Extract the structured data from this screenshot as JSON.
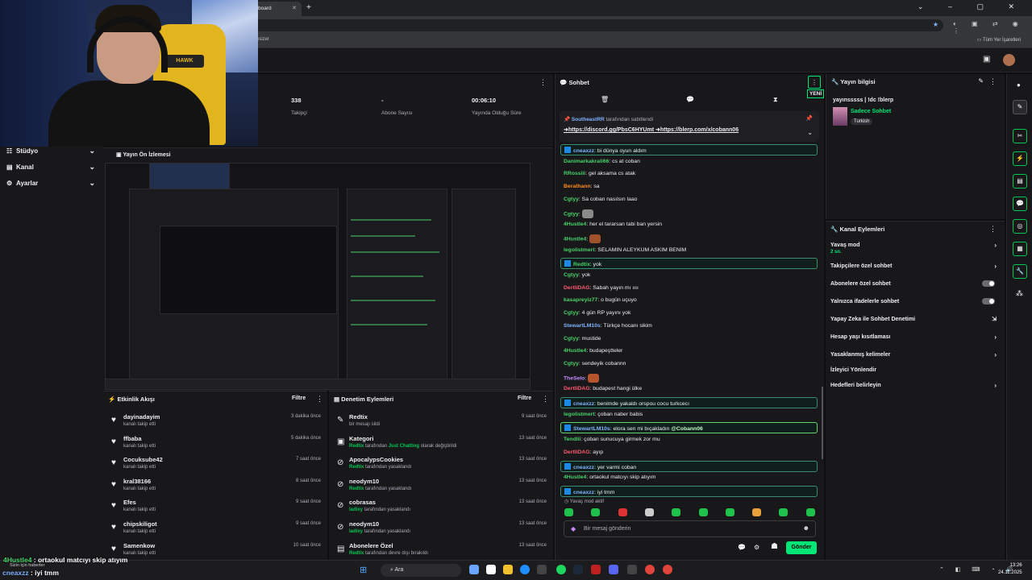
{
  "browser": {
    "tab_title": "board",
    "bookmarks_left": "esizer",
    "bookmarks_right": "Tüm Yer İşaretleri"
  },
  "nav": {
    "items": [
      {
        "label": "Stüdyo"
      },
      {
        "label": "Kanal"
      },
      {
        "label": "Ayarlar"
      }
    ]
  },
  "stats": {
    "items": [
      {
        "value": "338",
        "label": "Takipçi"
      },
      {
        "value": "-",
        "label": "Abone Sayısı"
      },
      {
        "value": "00:06:10",
        "label": "Yayında Olduğu Süre"
      }
    ]
  },
  "preview": {
    "title": "Yayın Ön İzlemesi"
  },
  "feed": {
    "title": "Etkinlik Akışı",
    "filter": "Filtre",
    "items": [
      {
        "name": "dayinadayim",
        "sub": "kanalı takip etti",
        "time": "3 dakika önce"
      },
      {
        "name": "ffbaba",
        "sub": "kanalı takip etti",
        "time": "5 dakika önce"
      },
      {
        "name": "Cocuksube42",
        "sub": "kanalı takip etti",
        "time": "7 saat önce"
      },
      {
        "name": "kral38166",
        "sub": "kanalı takip etti",
        "time": "8 saat önce"
      },
      {
        "name": "Efes",
        "sub": "kanalı takip etti",
        "time": "9 saat önce"
      },
      {
        "name": "chipskiligot",
        "sub": "kanalı takip etti",
        "time": "9 saat önce"
      },
      {
        "name": "Samenkow",
        "sub": "kanalı takip etti",
        "time": "10 saat önce"
      }
    ]
  },
  "mod": {
    "title": "Denetim Eylemleri",
    "filter": "Filtre",
    "items": [
      {
        "name": "Redtix",
        "actor": "",
        "sub": "bir mesajı sildi",
        "time": "9 saat önce"
      },
      {
        "name": "Kategori",
        "actor": "Redtix",
        "sub": " tarafından ",
        "extra": "Just Chatting",
        "sub2": " olarak değiştirildi",
        "time": "13 saat önce"
      },
      {
        "name": "ApocalypsCookies",
        "actor": "Redtix",
        "sub": " tarafından yasaklandı",
        "time": "13 saat önce"
      },
      {
        "name": "neodym10",
        "actor": "Redtix",
        "sub": " tarafından yasaklandı",
        "time": "13 saat önce"
      },
      {
        "name": "cobrasas",
        "actor": "ladixy",
        "sub": " tarafından yasaklandı",
        "time": "13 saat önce"
      },
      {
        "name": "neodym10",
        "actor": "ladixy",
        "sub": " tarafından yasaklandı",
        "time": "13 saat önce"
      },
      {
        "name": "Abonelere Özel",
        "actor": "Redtix",
        "sub": " tarafından devre dışı bırakıldı",
        "time": "13 saat önce"
      }
    ]
  },
  "chat": {
    "title": "Sohbet",
    "new_badge": "YENİ",
    "pinned_by": "SoutheastRR",
    "pinned_suffix": " tarafından sabitlendi",
    "pinned_text": "➜https://discord.gg/PbsC6HYUmt ➜https://blerp.com/x/cobann06",
    "slow_mode": "Yavaş mod aktif",
    "input_placeholder": "Bir mesaj gönderin",
    "send": "Gönder",
    "messages": [
      {
        "user": "cneaxzz",
        "color": "#7fb2ff",
        "text": ": bi dünya oyun aldım",
        "hl": true
      },
      {
        "user": "Danimarkakrali66",
        "color": "#48d26a",
        "text": ": cs at coban"
      },
      {
        "user": "RRossiii",
        "color": "#48d26a",
        "text": ": gel aksama cs atak"
      },
      {
        "user": "Berathann",
        "color": "#ff8c1a",
        "text": ": sa"
      },
      {
        "user": "Cgtyy",
        "color": "#48d26a",
        "text": ": Sa coban nasılsın laao"
      },
      {
        "user": "Cgtyy",
        "color": "#48d26a",
        "text": ":",
        "emote": "#8a8a8a"
      },
      {
        "user": "4Hustle4",
        "color": "#48d26a",
        "text": ": her el tararsan tabi ban yersin"
      },
      {
        "user": "4Hustle4",
        "color": "#48d26a",
        "text": ":",
        "emote": "#a0522d"
      },
      {
        "user": "legolistmert",
        "color": "#48d26a",
        "text": ": SELAMIN ALEYKÜM ASKIM BENİM"
      },
      {
        "user": "Redtix",
        "color": "#48d26a",
        "text": ": yok",
        "hl": true
      },
      {
        "user": "Cgtyy",
        "color": "#48d26a",
        "text": ": yok"
      },
      {
        "user": "DertliDAG",
        "color": "#ff5a6e",
        "text": ": Sabah yayın mı ıııı"
      },
      {
        "user": "kasapreyiz77",
        "color": "#48d26a",
        "text": ": o bugün uçuyo"
      },
      {
        "user": "Cgtyy",
        "color": "#48d26a",
        "text": ": 4 gün RP yayını yok"
      },
      {
        "user": "StewartLM10s",
        "color": "#7fb2ff",
        "text": ": Türkçe hocanı sikim"
      },
      {
        "user": "Cgtyy",
        "color": "#48d26a",
        "text": ": mustide"
      },
      {
        "user": "4Hustle4",
        "color": "#48d26a",
        "text": ": budapeştteler"
      },
      {
        "user": "Cgtyy",
        "color": "#48d26a",
        "text": ": sendeyik cobannn"
      },
      {
        "user": "TheSelo",
        "color": "#c58bff",
        "text": ":",
        "emote": "#b5542d"
      },
      {
        "user": "DertliDAG",
        "color": "#ff5a6e",
        "text": ": budapest hangi ülke"
      },
      {
        "user": "cneaxzz",
        "color": "#7fb2ff",
        "text": ": benimde yakaldı orspou cocu turkcecı",
        "hl": true
      },
      {
        "user": "legolistmert",
        "color": "#48d26a",
        "text": ": çoban naber babis"
      },
      {
        "user": "StewartLM10s",
        "color": "#7fb2ff",
        "text": ": elora sen mi bıçakladın ",
        "mention": "@Cobann06",
        "hl": true,
        "hlg": true
      },
      {
        "user": "Tendlii",
        "color": "#48d26a",
        "text": ": çoban sunucuya girmek zor mu"
      },
      {
        "user": "DertliDAG",
        "color": "#ff5a6e",
        "text": ": ayıp"
      },
      {
        "user": "cneaxzz",
        "color": "#7fb2ff",
        "text": ": yer varmi coban",
        "hl": true
      },
      {
        "user": "4Hustle4",
        "color": "#48d26a",
        "text": ": ortaokul matcıyı skip atıyım"
      },
      {
        "user": "cneaxzz",
        "color": "#7fb2ff",
        "text": ": iyi tmm",
        "hl": true
      }
    ]
  },
  "info": {
    "title": "Yayın bilgisi",
    "stream_title": "yayınsssss | !dc !blerp",
    "category": "Sadece Sohbet",
    "tag": "Turkish"
  },
  "actions": {
    "title": "Kanal Eylemleri",
    "items": [
      {
        "label": "Yavaş mod",
        "sub": "2 sn.",
        "ctl": "arrow"
      },
      {
        "label": "Takipçilere özel sohbet",
        "ctl": "arrow"
      },
      {
        "label": "Abonelere özel sohbet",
        "ctl": "toggle"
      },
      {
        "label": "Yalnızca ifadelerle sohbet",
        "ctl": "toggle"
      },
      {
        "label": "Yapay Zeka ile Sohbet Denetimi",
        "ctl": "ext"
      },
      {
        "label": "Hesap yaşı kısıtlaması",
        "ctl": "arrow"
      },
      {
        "label": "Yasaklanmış kelimeler",
        "ctl": "arrow"
      },
      {
        "label": "İzleyici Yönlendir",
        "ctl": "none"
      },
      {
        "label": "Hedefleri belirleyin",
        "ctl": "arrow"
      }
    ]
  },
  "taskbar": {
    "search": "Ara",
    "time": "13:26",
    "date": "24.11.2025"
  },
  "overlay": {
    "line1_user": "4Hustle4",
    "line1_text": " : ortaokul matcıyı skip atıyım",
    "sub": "Sizin için haberler",
    "line2_user": "cneaxzz",
    "line2_text": " : iyi tmm"
  },
  "colors": {
    "accent": "#00e676",
    "panel": "#18181b",
    "bg": "#0e0e10"
  }
}
